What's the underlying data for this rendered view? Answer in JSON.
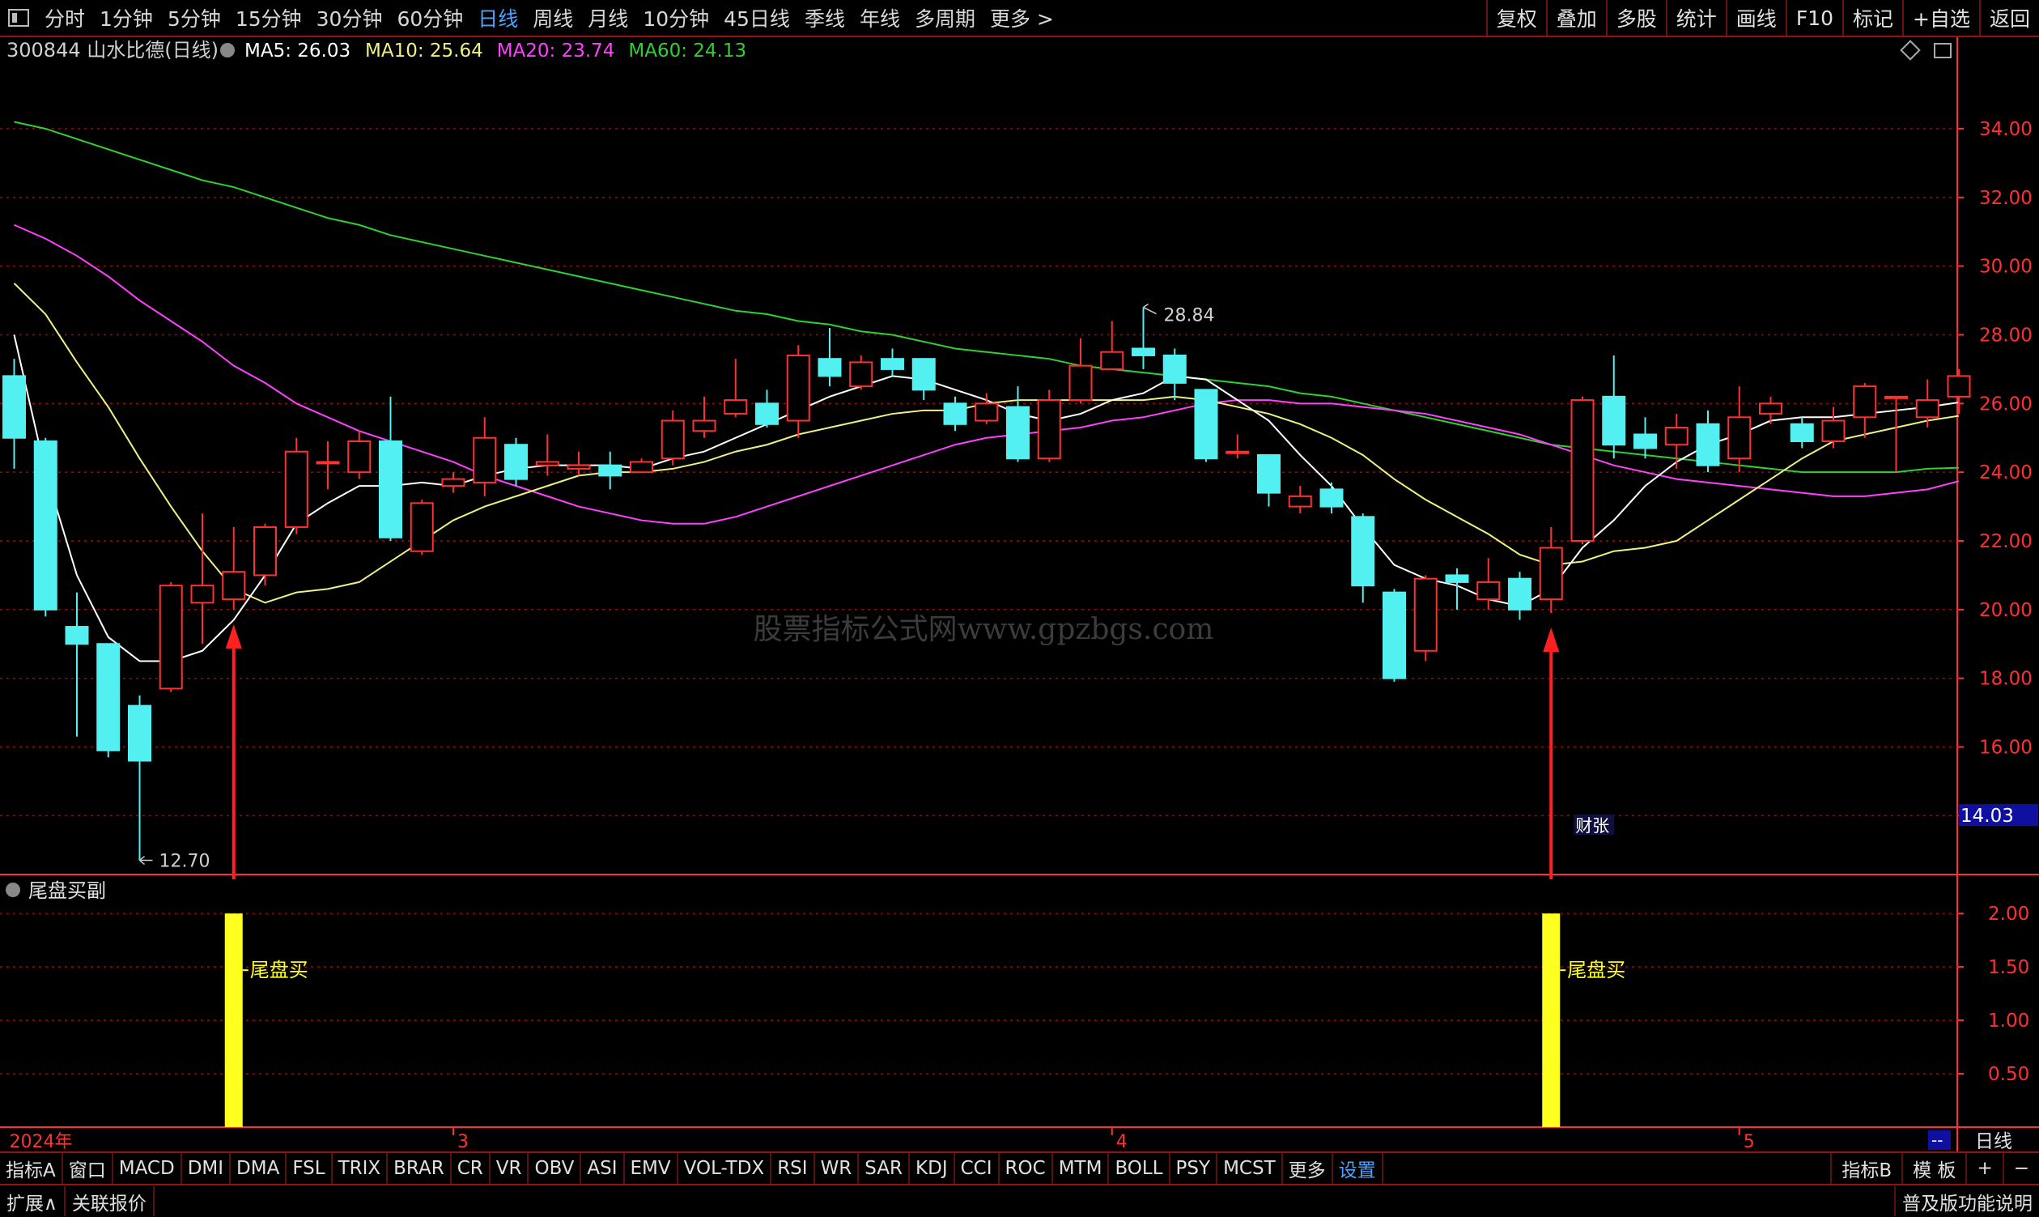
{
  "toolbar": {
    "periods": [
      "分时",
      "1分钟",
      "5分钟",
      "15分钟",
      "30分钟",
      "60分钟",
      "日线",
      "周线",
      "月线",
      "10分钟",
      "45日线",
      "季线",
      "年线",
      "多周期",
      "更多 >"
    ],
    "active_period": "日线",
    "right_buttons": [
      "复权",
      "叠加",
      "多股",
      "统计",
      "画线",
      "F10",
      "标记",
      "+自选",
      "返回"
    ]
  },
  "stock": {
    "code_name": "300844 山水比德(日线)"
  },
  "ma": [
    {
      "label": "MA5: 26.03",
      "color": "#ffffff"
    },
    {
      "label": "MA10: 25.64",
      "color": "#f0f080"
    },
    {
      "label": "MA20: 23.74",
      "color": "#ff40ff"
    },
    {
      "label": "MA60: 24.13",
      "color": "#30d030"
    }
  ],
  "colors": {
    "up": "#ff3030",
    "down": "#52f0f0",
    "grid": "#8b1010",
    "axis": "#ff3030",
    "indicator_bar": "#ffff20"
  },
  "price_axis": {
    "ticks": [
      "34.00",
      "32.00",
      "30.00",
      "28.00",
      "26.00",
      "24.00",
      "22.00",
      "20.00",
      "18.00",
      "16.00",
      "14.00"
    ],
    "current": "14.03"
  },
  "annotations": {
    "high": "28.84",
    "low": "12.70",
    "news": "财张",
    "watermark": "股票指标公式网www.gpzbgs.com"
  },
  "sub_chart": {
    "title": "尾盘买副",
    "ticks": [
      "2.00",
      "1.50",
      "1.00",
      "0.50"
    ],
    "signal_label": "尾盘买",
    "signal_value": 2.0,
    "signal_days": [
      7,
      49
    ]
  },
  "dates": {
    "labels": [
      "2024年",
      "3",
      "4",
      "5"
    ],
    "positions": [
      0,
      14,
      35,
      55
    ],
    "corner": "--",
    "period_btn": "日线"
  },
  "bottom_tabs": {
    "indicators": [
      "指标A",
      "窗口",
      "MACD",
      "DMI",
      "DMA",
      "FSL",
      "TRIX",
      "BRAR",
      "CR",
      "VR",
      "OBV",
      "ASI",
      "EMV",
      "VOL-TDX",
      "RSI",
      "WR",
      "SAR",
      "KDJ",
      "CCI",
      "ROC",
      "MTM",
      "BOLL",
      "PSY",
      "MCST",
      "更多",
      "设置"
    ],
    "right": [
      "指标B",
      "模 板",
      "+",
      "−"
    ]
  },
  "status": {
    "left": [
      "扩展∧",
      "关联报价"
    ],
    "right": "普及版功能说明"
  },
  "chart_data": {
    "type": "candlestick",
    "candles": [
      [
        26.8,
        25.0,
        27.3,
        24.1
      ],
      [
        24.9,
        20.0,
        25.0,
        19.8
      ],
      [
        19.5,
        19.0,
        20.5,
        16.3
      ],
      [
        19.0,
        15.9,
        19.0,
        15.7
      ],
      [
        17.2,
        15.6,
        17.5,
        12.7
      ],
      [
        17.7,
        20.7,
        20.8,
        17.6
      ],
      [
        20.2,
        20.7,
        22.8,
        19.0
      ],
      [
        20.3,
        21.1,
        22.4,
        20.0
      ],
      [
        21.0,
        22.4,
        22.5,
        20.7
      ],
      [
        22.4,
        24.6,
        25.0,
        22.2
      ],
      [
        24.3,
        24.3,
        24.9,
        23.5
      ],
      [
        24.0,
        24.9,
        25.2,
        23.8
      ],
      [
        24.9,
        22.1,
        26.2,
        22.0
      ],
      [
        21.7,
        23.1,
        23.2,
        21.6
      ],
      [
        23.6,
        23.8,
        24.0,
        23.4
      ],
      [
        23.7,
        25.0,
        25.6,
        23.3
      ],
      [
        24.8,
        23.8,
        25.0,
        23.6
      ],
      [
        24.2,
        24.3,
        25.1,
        23.9
      ],
      [
        24.1,
        24.2,
        24.6,
        23.9
      ],
      [
        24.2,
        23.9,
        24.6,
        23.5
      ],
      [
        24.0,
        24.3,
        24.4,
        24.0
      ],
      [
        24.4,
        25.5,
        25.8,
        24.2
      ],
      [
        25.2,
        25.5,
        26.2,
        25.0
      ],
      [
        25.7,
        26.1,
        27.3,
        25.6
      ],
      [
        26.0,
        25.4,
        26.4,
        25.3
      ],
      [
        25.5,
        27.4,
        27.7,
        25.0
      ],
      [
        27.3,
        26.8,
        28.2,
        26.5
      ],
      [
        26.5,
        27.2,
        27.4,
        26.4
      ],
      [
        27.3,
        27.0,
        27.6,
        26.8
      ],
      [
        27.3,
        26.4,
        27.3,
        26.1
      ],
      [
        26.0,
        25.4,
        26.2,
        25.2
      ],
      [
        25.5,
        26.0,
        26.3,
        25.4
      ],
      [
        25.9,
        24.4,
        26.5,
        24.3
      ],
      [
        24.4,
        26.1,
        26.4,
        24.3
      ],
      [
        26.1,
        27.1,
        27.9,
        26.0
      ],
      [
        27.0,
        27.5,
        28.4,
        27.0
      ],
      [
        27.6,
        27.4,
        28.8,
        27.0
      ],
      [
        27.4,
        26.6,
        27.6,
        26.1
      ],
      [
        26.4,
        24.4,
        26.4,
        24.3
      ],
      [
        24.6,
        24.6,
        25.1,
        24.4
      ],
      [
        24.5,
        23.4,
        24.5,
        23.0
      ],
      [
        23.0,
        23.3,
        23.6,
        22.8
      ],
      [
        23.5,
        23.0,
        23.7,
        22.8
      ],
      [
        22.7,
        20.7,
        22.8,
        20.2
      ],
      [
        20.5,
        18.0,
        20.6,
        17.9
      ],
      [
        18.8,
        20.9,
        21.0,
        18.5
      ],
      [
        21.0,
        20.8,
        21.2,
        20.0
      ],
      [
        20.3,
        20.8,
        21.5,
        20.0
      ],
      [
        20.9,
        20.0,
        21.1,
        19.7
      ],
      [
        20.3,
        21.8,
        22.4,
        19.9
      ],
      [
        22.0,
        26.1,
        26.2,
        21.9
      ],
      [
        26.2,
        24.8,
        27.4,
        24.4
      ],
      [
        25.1,
        24.7,
        25.6,
        24.4
      ],
      [
        24.8,
        25.3,
        25.7,
        24.1
      ],
      [
        25.4,
        24.2,
        25.8,
        24.0
      ],
      [
        24.4,
        25.6,
        26.5,
        24.0
      ],
      [
        25.7,
        26.0,
        26.2,
        25.4
      ],
      [
        25.4,
        24.9,
        25.6,
        24.7
      ],
      [
        24.9,
        25.5,
        25.9,
        24.7
      ],
      [
        25.6,
        26.5,
        26.6,
        25.0
      ],
      [
        26.2,
        26.2,
        26.2,
        24.0
      ],
      [
        25.6,
        26.1,
        26.7,
        25.3
      ],
      [
        26.2,
        26.8,
        27.0,
        25.7
      ]
    ],
    "ma5": [
      28.0,
      24.0,
      21.0,
      19.2,
      18.5,
      18.5,
      18.8,
      19.7,
      21.0,
      22.5,
      23.1,
      23.6,
      23.6,
      23.7,
      23.6,
      23.9,
      24.1,
      24.2,
      24.2,
      24.2,
      24.1,
      24.4,
      24.6,
      25.0,
      25.4,
      25.8,
      26.2,
      26.5,
      26.8,
      26.7,
      26.4,
      26.1,
      25.7,
      25.5,
      25.7,
      26.1,
      26.3,
      26.8,
      26.7,
      26.1,
      25.5,
      24.5,
      23.6,
      22.4,
      21.3,
      20.9,
      20.7,
      20.3,
      20.1,
      20.6,
      21.8,
      22.6,
      23.6,
      24.3,
      24.8,
      25.1,
      25.5,
      25.6,
      25.6,
      25.7,
      25.8,
      25.9,
      26.03
    ],
    "ma10": [
      29.5,
      28.6,
      27.2,
      25.9,
      24.4,
      23.0,
      21.7,
      20.6,
      20.2,
      20.5,
      20.6,
      20.8,
      21.4,
      22.0,
      22.6,
      23.0,
      23.3,
      23.6,
      23.9,
      24.0,
      24.0,
      24.1,
      24.3,
      24.6,
      24.8,
      25.1,
      25.3,
      25.5,
      25.7,
      25.8,
      25.8,
      26.0,
      26.1,
      26.1,
      26.1,
      26.1,
      26.1,
      26.2,
      26.1,
      25.9,
      25.7,
      25.4,
      25.0,
      24.5,
      23.8,
      23.2,
      22.7,
      22.2,
      21.6,
      21.3,
      21.4,
      21.7,
      21.8,
      22.0,
      22.6,
      23.2,
      23.8,
      24.4,
      24.9,
      25.1,
      25.3,
      25.5,
      25.64
    ],
    "ma20": [
      31.2,
      30.8,
      30.3,
      29.7,
      29.0,
      28.4,
      27.8,
      27.1,
      26.6,
      26.0,
      25.6,
      25.2,
      24.9,
      24.6,
      24.3,
      23.9,
      23.6,
      23.3,
      23.0,
      22.8,
      22.6,
      22.5,
      22.5,
      22.7,
      23.0,
      23.3,
      23.6,
      23.9,
      24.2,
      24.5,
      24.8,
      25.0,
      25.1,
      25.2,
      25.3,
      25.5,
      25.6,
      25.8,
      26.0,
      26.1,
      26.1,
      26.0,
      26.0,
      25.9,
      25.8,
      25.7,
      25.5,
      25.3,
      25.1,
      24.8,
      24.5,
      24.2,
      24.0,
      23.8,
      23.7,
      23.6,
      23.5,
      23.4,
      23.3,
      23.3,
      23.4,
      23.5,
      23.74
    ],
    "ma60": [
      34.2,
      34.0,
      33.7,
      33.4,
      33.1,
      32.8,
      32.5,
      32.3,
      32.0,
      31.7,
      31.4,
      31.2,
      30.9,
      30.7,
      30.5,
      30.3,
      30.1,
      29.9,
      29.7,
      29.5,
      29.3,
      29.1,
      28.9,
      28.7,
      28.6,
      28.4,
      28.3,
      28.1,
      28.0,
      27.8,
      27.6,
      27.5,
      27.4,
      27.3,
      27.1,
      27.0,
      26.9,
      26.8,
      26.7,
      26.6,
      26.5,
      26.3,
      26.2,
      26.0,
      25.8,
      25.6,
      25.4,
      25.2,
      25.0,
      24.8,
      24.7,
      24.6,
      24.5,
      24.4,
      24.3,
      24.2,
      24.1,
      24.0,
      24.0,
      24.0,
      24.0,
      24.1,
      24.13
    ]
  }
}
